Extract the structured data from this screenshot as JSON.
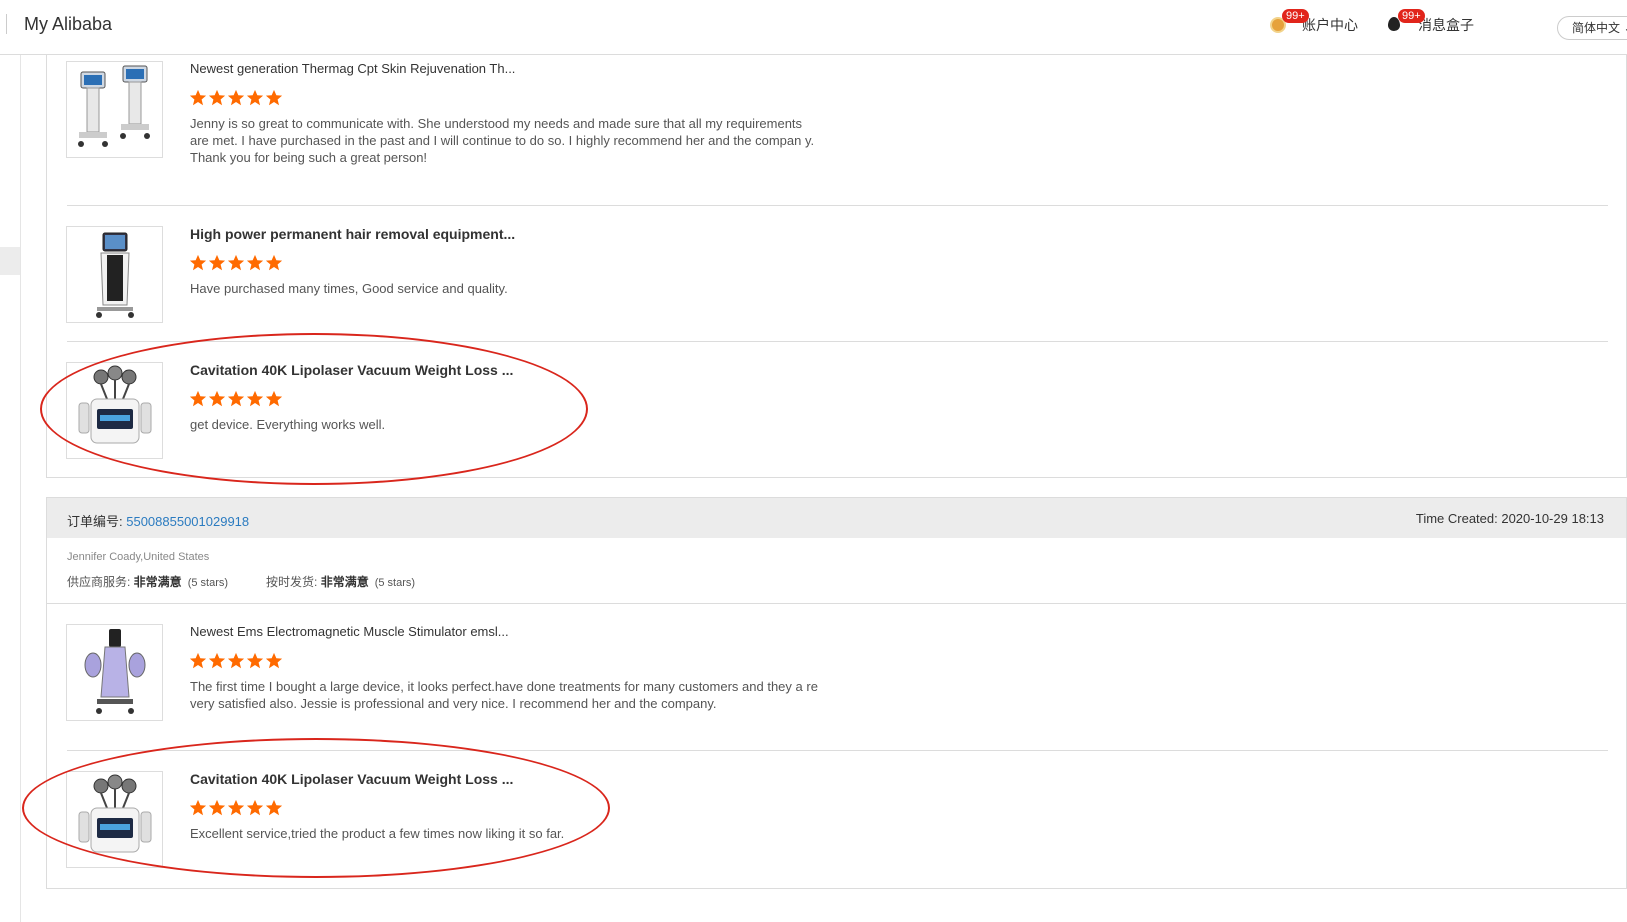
{
  "header": {
    "brand": "My Alibaba",
    "account": {
      "label": "账户中心",
      "badge": "99+"
    },
    "messages": {
      "label": "消息盒子",
      "badge": "99+"
    },
    "language": "简体中文"
  },
  "colors": {
    "star": "#ff6a00",
    "link": "#2b7bc0",
    "highlight": "#d9261c"
  },
  "order1": {
    "items": [
      {
        "title": "Newest generation Thermag Cpt Skin Rejuvenation Th...",
        "rating": 5,
        "comment": "Jenny is so great to communicate with. She understood my needs and made sure that all my requirements are met. I have purchased in the past and I will continue to do so. I highly recommend her and the compan y. Thank you for being such a great person!"
      },
      {
        "title": "High power permanent hair removal equipment...",
        "rating": 5,
        "comment": "Have purchased many times, Good service and quality."
      },
      {
        "title": "Cavitation 40K Lipolaser Vacuum Weight Loss ...",
        "rating": 5,
        "comment": "get device. Everything works well."
      }
    ]
  },
  "order2": {
    "order_label": "订单编号: ",
    "order_number": "55008855001029918",
    "time_created": "Time Created: 2020-10-29 18:13",
    "buyer": "Jennifer Coady,United States",
    "supplier_service": {
      "label": "供应商服务: ",
      "value": "非常满意",
      "stars": "(5 stars)"
    },
    "on_time_delivery": {
      "label": "按时发货: ",
      "value": "非常满意",
      "stars": "(5 stars)"
    },
    "items": [
      {
        "title": "Newest Ems Electromagnetic Muscle Stimulator emsl...",
        "rating": 5,
        "comment": "The first time I bought a large device, it looks perfect.have done treatments for many customers and they a re very satisfied also. Jessie is professional and very nice. I recommend her and the company."
      },
      {
        "title": "Cavitation 40K Lipolaser Vacuum Weight Loss ...",
        "rating": 5,
        "comment": "Excellent service,tried the product a few times now liking it so far."
      }
    ]
  }
}
